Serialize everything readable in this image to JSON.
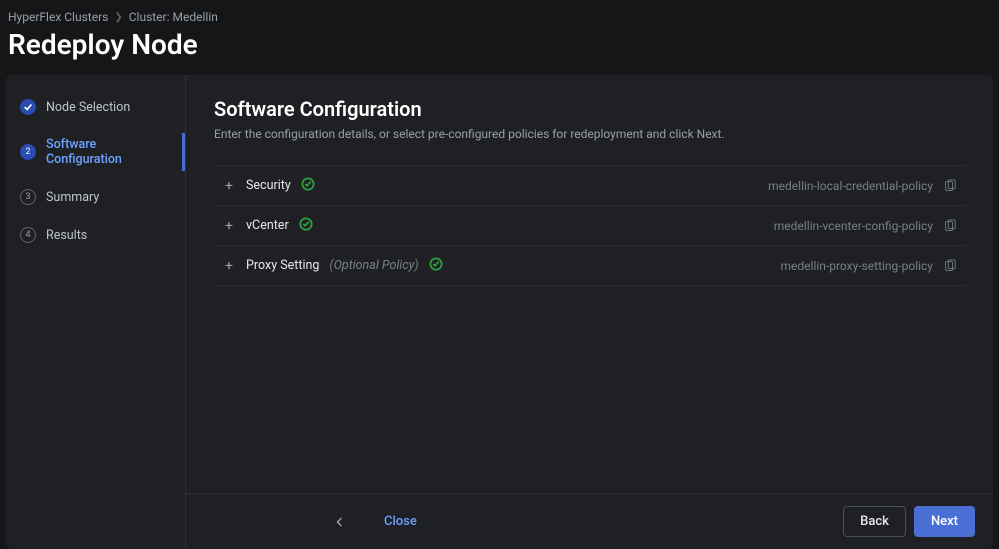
{
  "breadcrumb": {
    "root": "HyperFlex Clusters",
    "current": "Cluster: Medellin"
  },
  "page_title": "Redeploy Node",
  "sidebar": {
    "steps": [
      {
        "label": "Node Selection",
        "state": "completed",
        "badge": "check"
      },
      {
        "label": "Software Configuration",
        "state": "active",
        "badge": "2"
      },
      {
        "label": "Summary",
        "state": "pending",
        "badge": "3"
      },
      {
        "label": "Results",
        "state": "pending",
        "badge": "4"
      }
    ]
  },
  "content": {
    "title": "Software Configuration",
    "subtitle": "Enter the configuration details, or select pre-configured policies for redeployment and click Next.",
    "rows": [
      {
        "label": "Security",
        "optional": "",
        "has_check": true,
        "value": "medellin-local-credential-policy"
      },
      {
        "label": "vCenter",
        "optional": "",
        "has_check": true,
        "value": "medellin-vcenter-config-policy"
      },
      {
        "label": "Proxy Setting",
        "optional": "(Optional Policy)",
        "has_check": true,
        "value": "medellin-proxy-setting-policy"
      }
    ]
  },
  "footer": {
    "close": "Close",
    "back": "Back",
    "next": "Next"
  }
}
